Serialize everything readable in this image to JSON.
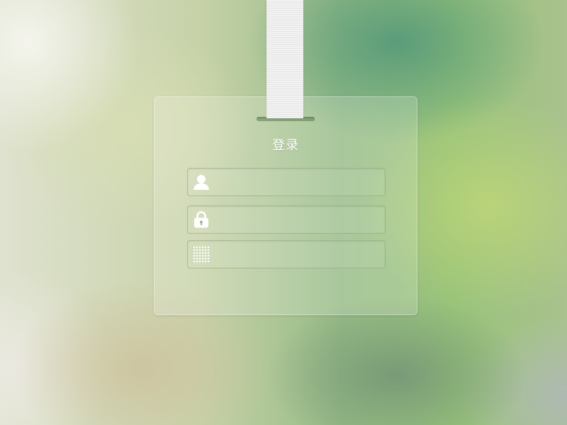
{
  "login": {
    "title": "登录",
    "fields": [
      {
        "name": "username",
        "icon": "user-icon",
        "value": "",
        "placeholder": ""
      },
      {
        "name": "password",
        "icon": "lock-icon",
        "value": "",
        "placeholder": ""
      },
      {
        "name": "verification-code",
        "icon": "keypad-icon",
        "value": "",
        "placeholder": ""
      }
    ]
  },
  "colors": {
    "card_text": "#ffffff",
    "lanyard": "#f2f2f2",
    "background_green": "#98c37a"
  }
}
